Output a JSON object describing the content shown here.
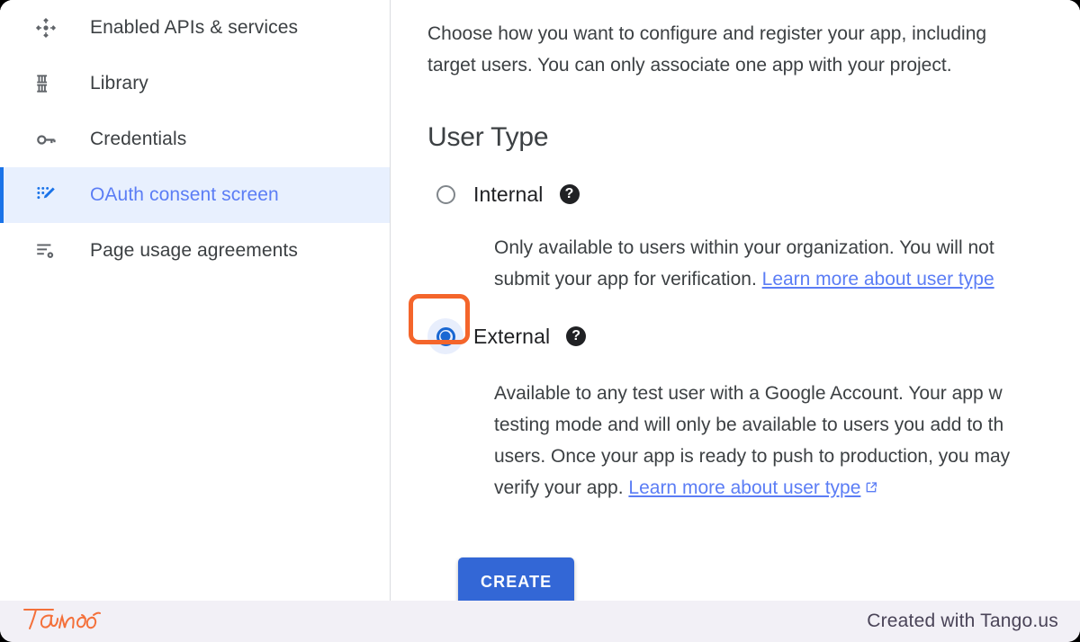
{
  "sidebar": {
    "items": [
      {
        "label": "Enabled APIs & services",
        "icon": "api-hub-icon",
        "active": false
      },
      {
        "label": "Library",
        "icon": "library-icon",
        "active": false
      },
      {
        "label": "Credentials",
        "icon": "key-icon",
        "active": false
      },
      {
        "label": "OAuth consent screen",
        "icon": "oauth-consent-icon",
        "active": true
      },
      {
        "label": "Page usage agreements",
        "icon": "page-usage-agreements-icon",
        "active": false
      }
    ]
  },
  "content": {
    "intro_line1": "Choose how you want to configure and register your app, including",
    "intro_line2": "target users. You can only associate one app with your project.",
    "section_title": "User Type",
    "options": [
      {
        "label": "Internal",
        "selected": false,
        "help_icon": "help-icon",
        "desc_line1": "Only available to users within your organization. You will not",
        "desc_line2_text": "submit your app for verification. ",
        "desc_line2_link": "Learn more about user type"
      },
      {
        "label": "External",
        "selected": true,
        "help_icon": "help-icon",
        "desc_line1": "Available to any test user with a Google Account. Your app w",
        "desc_line2": "testing mode and will only be available to users you add to th",
        "desc_line3": "users. Once your app is ready to push to production, you may",
        "desc_line4_text": "verify your app. ",
        "desc_line4_link": "Learn more about user type"
      }
    ],
    "create_button": "CREATE"
  },
  "footer": {
    "logo_text": "Tango",
    "credit": "Created with Tango.us"
  },
  "colors": {
    "accent_blue": "#1a73e8",
    "link_blue": "#5b7df5",
    "button_blue": "#3367d6",
    "highlight_orange": "#f4652b",
    "active_row_bg": "#e8f0fe",
    "footer_bg": "#f2f0f6",
    "logo_orange": "#f4703a"
  }
}
